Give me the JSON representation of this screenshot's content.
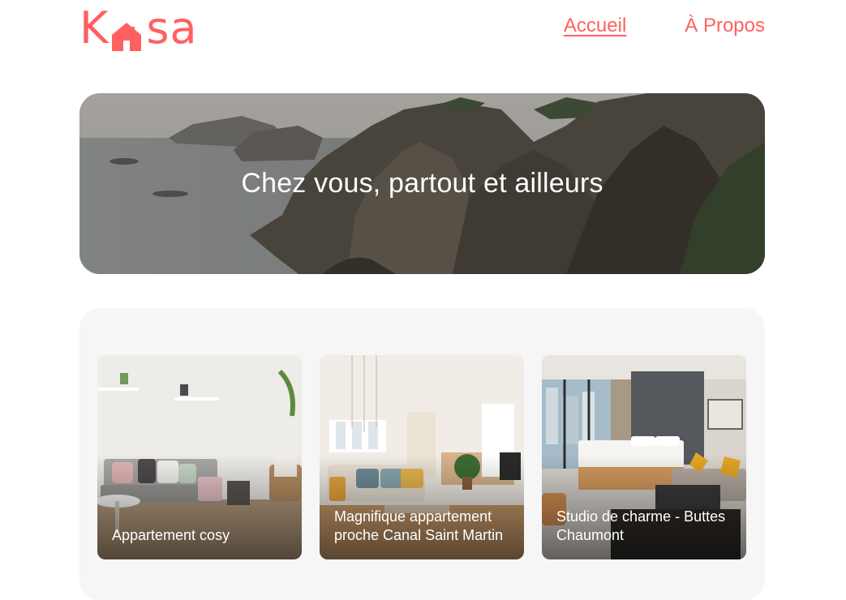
{
  "brand": {
    "logo_left": "K",
    "logo_right": "sa",
    "color": "#FF6060"
  },
  "nav": {
    "home_label": "Accueil",
    "about_label": "À Propos"
  },
  "banner": {
    "title": "Chez vous, partout et ailleurs"
  },
  "listings": [
    {
      "title": "Appartement cosy"
    },
    {
      "title": "Magnifique appartement proche Canal Saint Martin"
    },
    {
      "title": "Studio de charme - Buttes Chaumont"
    }
  ]
}
